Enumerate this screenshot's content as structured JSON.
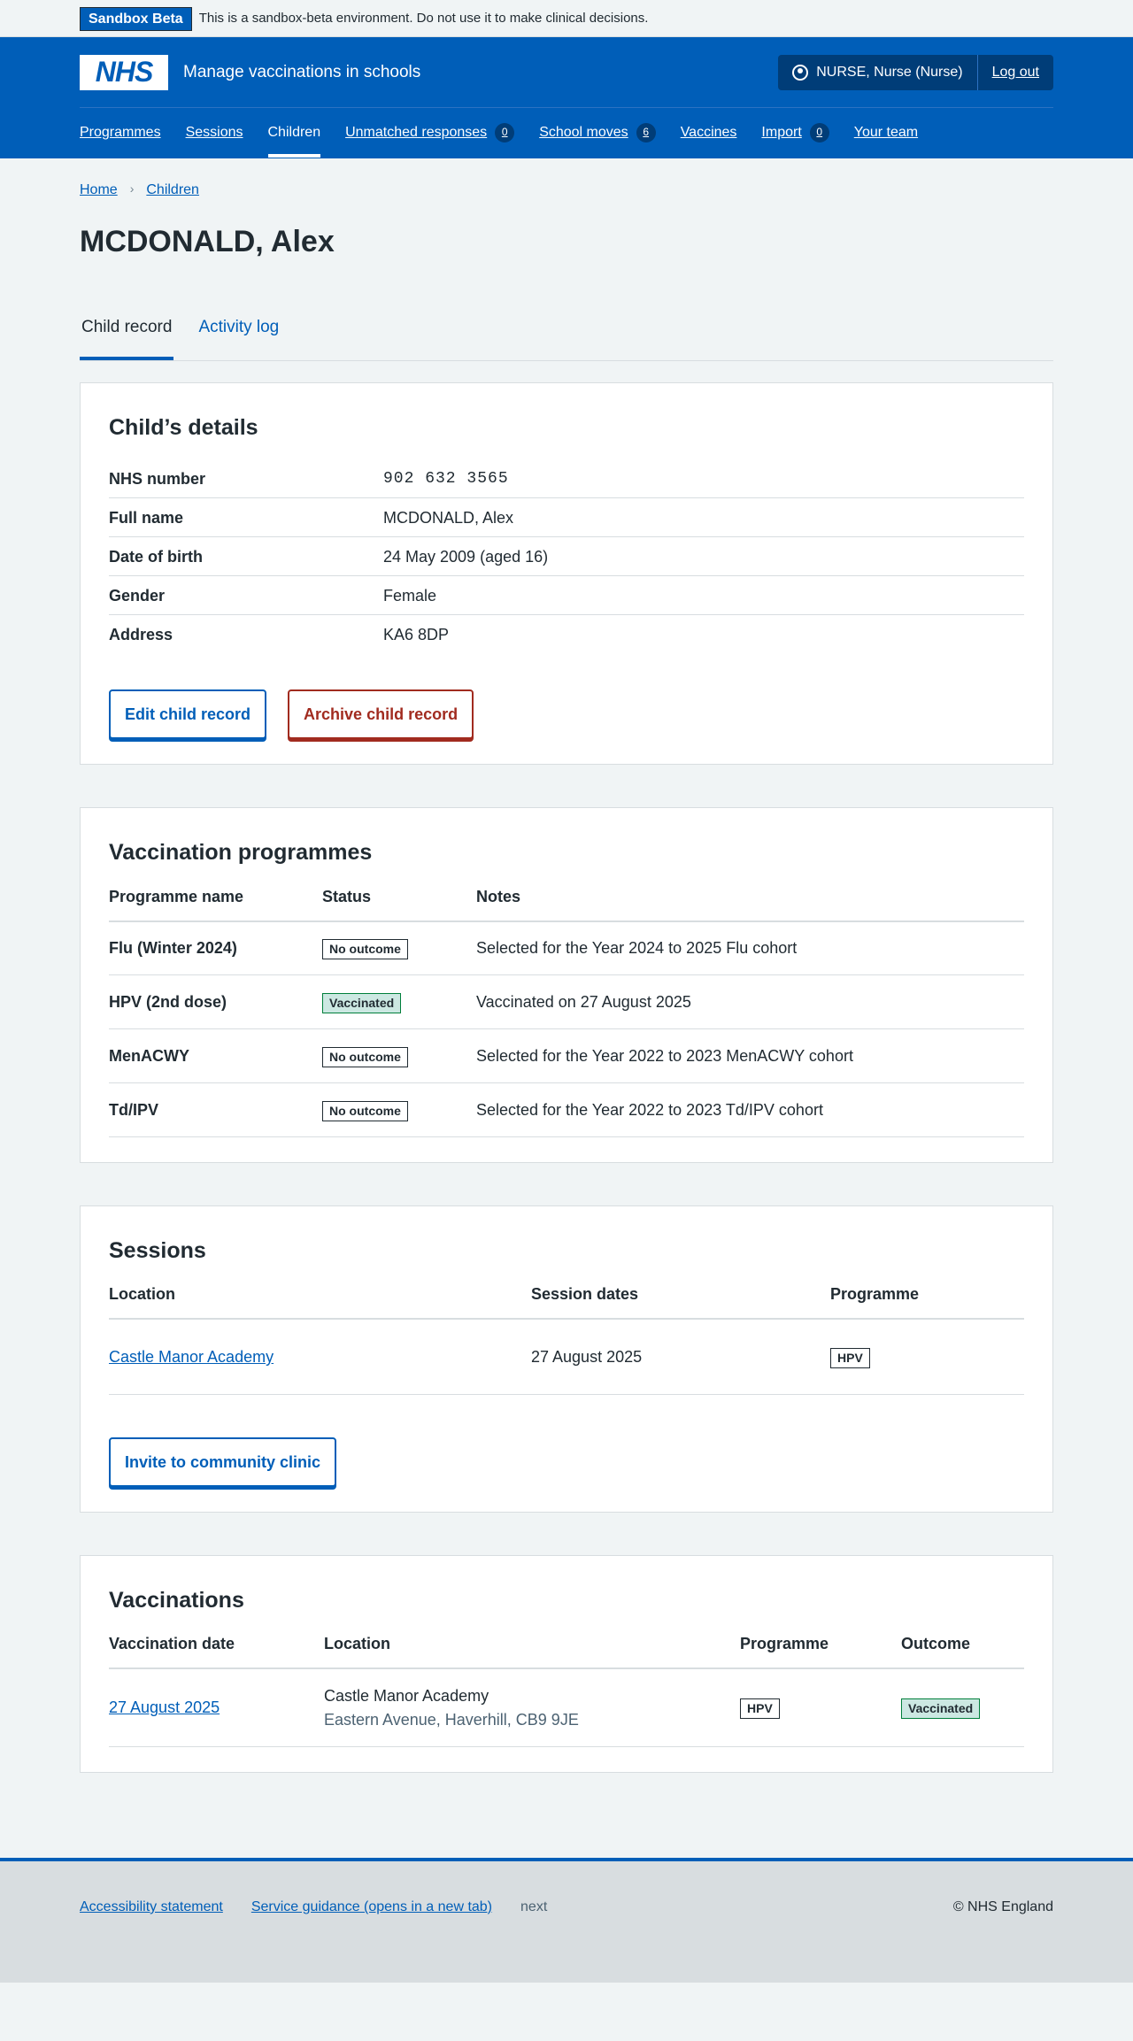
{
  "sandbox": {
    "tag": "Sandbox Beta",
    "message": "This is a sandbox-beta environment. Do not use it to make clinical decisions."
  },
  "header": {
    "logo": "NHS",
    "service_name": "Manage vaccinations in schools",
    "user": "NURSE, Nurse (Nurse)",
    "logout": "Log out"
  },
  "nav": {
    "programmes": "Programmes",
    "sessions": "Sessions",
    "children": "Children",
    "unmatched": "Unmatched responses",
    "unmatched_count": "0",
    "school_moves": "School moves",
    "school_moves_count": "6",
    "vaccines": "Vaccines",
    "import": "Import",
    "import_count": "0",
    "team": "Your team"
  },
  "breadcrumb": {
    "home": "Home",
    "children": "Children",
    "sep": "›"
  },
  "page_title": "MCDONALD, Alex",
  "tabs": {
    "child_record": "Child record",
    "activity_log": "Activity log"
  },
  "details": {
    "heading": "Child’s details",
    "nhs_label": "NHS number",
    "nhs_value": "902 632 3565",
    "name_label": "Full name",
    "name_value": "MCDONALD, Alex",
    "dob_label": "Date of birth",
    "dob_value": "24 May 2009 (aged 16)",
    "gender_label": "Gender",
    "gender_value": "Female",
    "address_label": "Address",
    "address_value": "KA6 8DP",
    "edit_button": "Edit child record",
    "archive_button": "Archive child record"
  },
  "programmes": {
    "heading": "Vaccination programmes",
    "col_name": "Programme name",
    "col_status": "Status",
    "col_notes": "Notes",
    "rows": [
      {
        "name": "Flu (Winter 2024)",
        "status": "No outcome",
        "notes": "Selected for the Year 2024 to 2025 Flu cohort"
      },
      {
        "name": "HPV (2nd dose)",
        "status": "Vaccinated",
        "notes": "Vaccinated on 27 August 2025"
      },
      {
        "name": "MenACWY",
        "status": "No outcome",
        "notes": "Selected for the Year 2022 to 2023 MenACWY cohort"
      },
      {
        "name": "Td/IPV",
        "status": "No outcome",
        "notes": "Selected for the Year 2022 to 2023 Td/IPV cohort"
      }
    ]
  },
  "sessions": {
    "heading": "Sessions",
    "col_location": "Location",
    "col_dates": "Session dates",
    "col_programme": "Programme",
    "row": {
      "location": "Castle Manor Academy",
      "dates": "27 August 2025",
      "programme": "HPV"
    },
    "invite_button": "Invite to community clinic"
  },
  "vaccinations": {
    "heading": "Vaccinations",
    "col_date": "Vaccination date",
    "col_location": "Location",
    "col_programme": "Programme",
    "col_outcome": "Outcome",
    "row": {
      "date": "27 August 2025",
      "location": "Castle Manor Academy",
      "address": "Eastern Avenue, Haverhill, CB9 9JE",
      "programme": "HPV",
      "outcome": "Vaccinated"
    }
  },
  "footer": {
    "accessibility": "Accessibility statement",
    "guidance": "Service guidance (opens in a new tab)",
    "next": "next",
    "copyright": "© NHS England"
  }
}
